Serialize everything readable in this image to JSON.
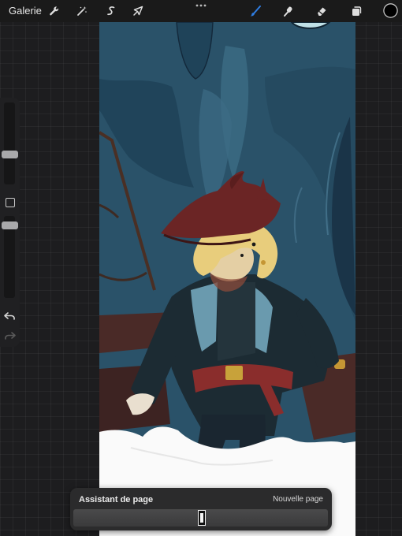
{
  "toolbar": {
    "gallery_label": "Galerie",
    "left_tools": [
      "wrench-icon",
      "magic-wand-icon",
      "selection-s-icon",
      "transform-arrow-icon"
    ],
    "right_tools": [
      "brush-icon",
      "smudge-icon",
      "eraser-icon",
      "layers-icon",
      "color-swatch"
    ],
    "active_tool": "brush-icon",
    "current_color": "#000000",
    "accent_color": "#2f7de1"
  },
  "sidebar": {
    "brush_size_slider": "size-slider",
    "modifier": "modifier-button",
    "opacity_slider": "opacity-slider",
    "undo_icon": "undo-icon",
    "redo_icon": "redo-icon"
  },
  "page_assistant": {
    "title": "Assistant de page",
    "new_page_label": "Nouvelle page"
  }
}
